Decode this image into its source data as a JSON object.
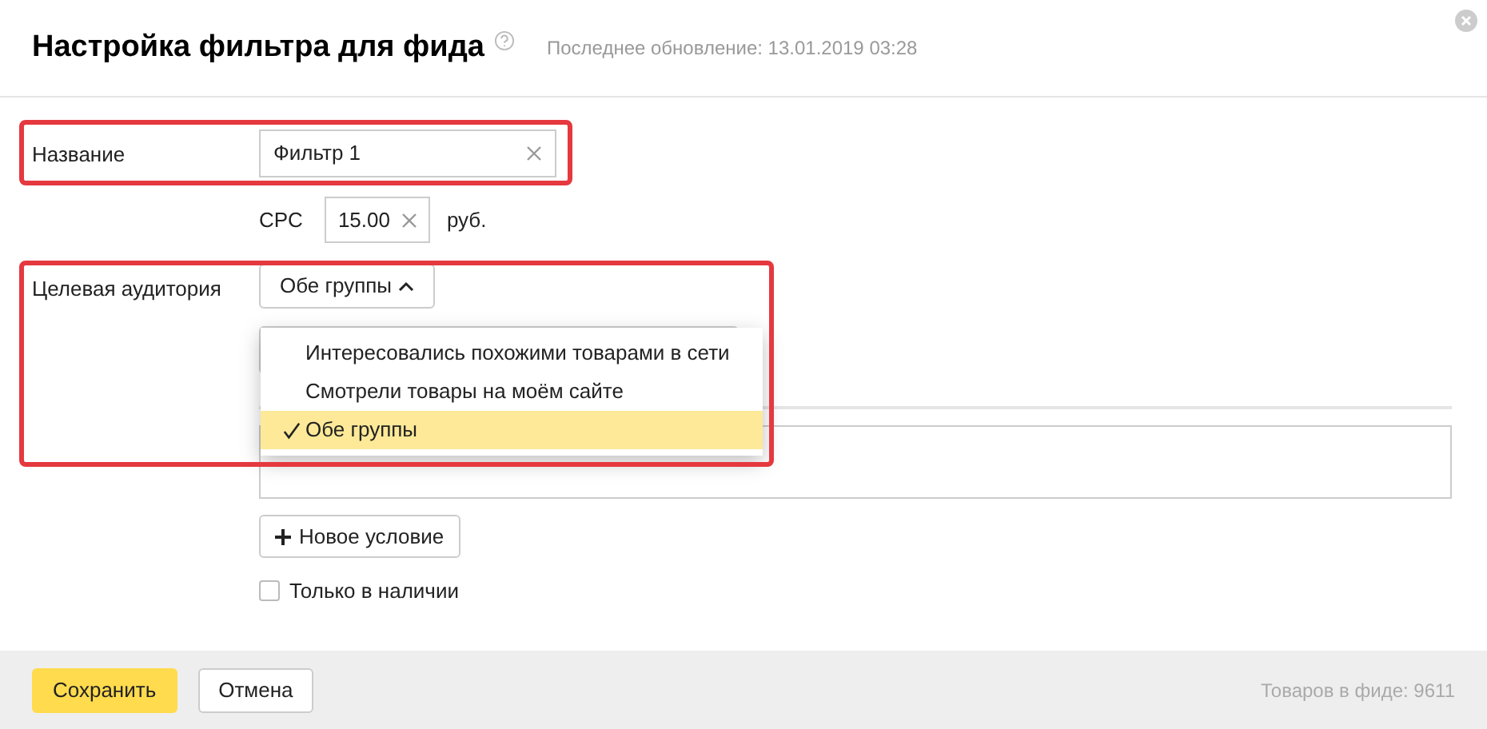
{
  "dialog": {
    "title": "Настройка фильтра для фида",
    "last_update": "Последнее обновление: 13.01.2019 03:28"
  },
  "name_field": {
    "label": "Название",
    "value": "Фильтр 1"
  },
  "cpc": {
    "label": "CPC",
    "value": "15.00",
    "unit": "руб."
  },
  "audience": {
    "label": "Целевая аудитория",
    "button": "Обе группы",
    "expanded": true,
    "options": [
      {
        "label": "Интересовались похожими товарами в сети",
        "selected": false
      },
      {
        "label": "Смотрели товары на моём сайте",
        "selected": false
      },
      {
        "label": "Обе группы",
        "selected": true
      }
    ]
  },
  "new_condition_button": "Новое условие",
  "in_stock": {
    "label": "Только в наличии",
    "checked": false
  },
  "footer": {
    "save": "Сохранить",
    "cancel": "Отмена",
    "count": "Товаров в фиде: 9611"
  }
}
